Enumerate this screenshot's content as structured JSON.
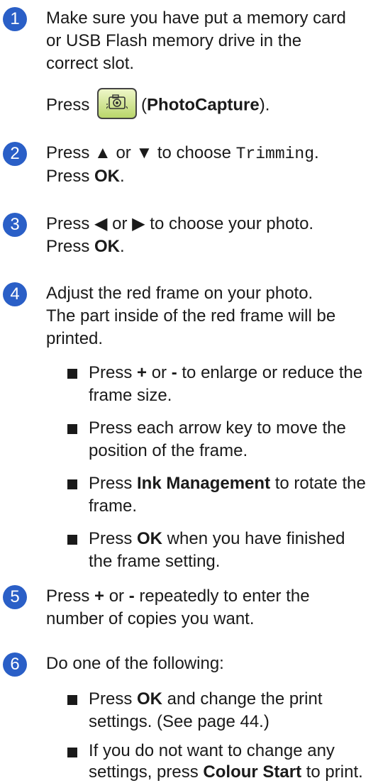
{
  "steps": [
    {
      "num": "1",
      "lines": [
        "Make sure you have put a memory card",
        "or USB Flash memory drive in the",
        "correct slot."
      ],
      "press_prefix": "Press",
      "button_name": "PhotoCapture"
    },
    {
      "num": "2",
      "line1_a": "Press ▲ or ▼ to choose ",
      "line1_code": "Trimming",
      "line1_end": ".",
      "line2_a": "Press ",
      "line2_b": "OK",
      "line2_end": "."
    },
    {
      "num": "3",
      "line1": "Press ◀ or ▶ to choose your photo.",
      "line2_a": "Press ",
      "line2_b": "OK",
      "line2_end": "."
    },
    {
      "num": "4",
      "lines": [
        "Adjust the red frame on your photo.",
        "The part inside of the red frame will be",
        "printed."
      ],
      "bullets": [
        {
          "pre": "Press ",
          "bold": "+",
          "mid": " or ",
          "bold2": "-",
          "post": " to enlarge or reduce the",
          "line2": "frame size."
        },
        {
          "pre": "Press each arrow key to move the",
          "line2": "position of the frame."
        },
        {
          "pre": "Press ",
          "bold": "Ink Management",
          "post": " to rotate the",
          "line2": "frame."
        },
        {
          "pre": "Press ",
          "bold": "OK",
          "post": " when you have finished",
          "line2": "the frame setting."
        }
      ]
    },
    {
      "num": "5",
      "line1_a": "Press ",
      "line1_b": "+",
      "line1_c": " or ",
      "line1_d": "-",
      "line1_e": " repeatedly to enter the",
      "line2": "number of copies you want."
    },
    {
      "num": "6",
      "line1": "Do one of the following:",
      "bullets": [
        {
          "pre": "Press ",
          "bold": "OK",
          "post": " and change the print",
          "line2": "settings. (See page 44.)"
        },
        {
          "pre": "If you do not want to change any",
          "line2_a": "settings, press ",
          "line2_b": "Colour Start",
          "line2_c": " to print."
        }
      ]
    }
  ]
}
